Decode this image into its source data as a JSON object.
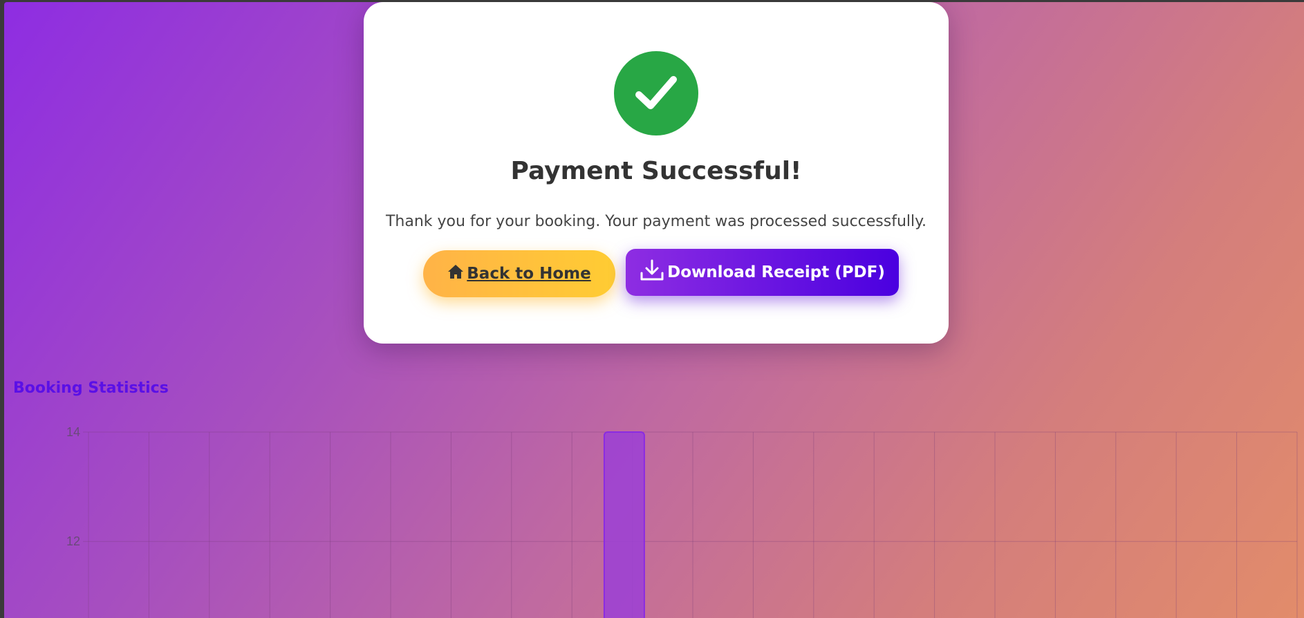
{
  "modal": {
    "title": "Payment Successful!",
    "message": "Thank you for your booking. Your payment was processed successfully.",
    "success_icon": "check-circle-icon",
    "success_color": "#28a745"
  },
  "actions": {
    "home_label": "Back to Home",
    "home_icon": "home-icon",
    "download_label": "Download Receipt (PDF)",
    "download_icon": "download-icon"
  },
  "stats": {
    "heading": "Booking Statistics"
  },
  "chart_data": {
    "type": "bar",
    "title": "",
    "xlabel": "",
    "ylabel": "",
    "y_ticks_visible": [
      14,
      12
    ],
    "ylim_visible": [
      10.6,
      14
    ],
    "grid": true,
    "category_count": 20,
    "values": [
      null,
      null,
      null,
      null,
      null,
      null,
      null,
      null,
      14,
      null,
      null,
      null,
      null,
      null,
      null,
      null,
      null,
      null,
      null,
      null
    ],
    "bar_color": "#9b40d6"
  }
}
